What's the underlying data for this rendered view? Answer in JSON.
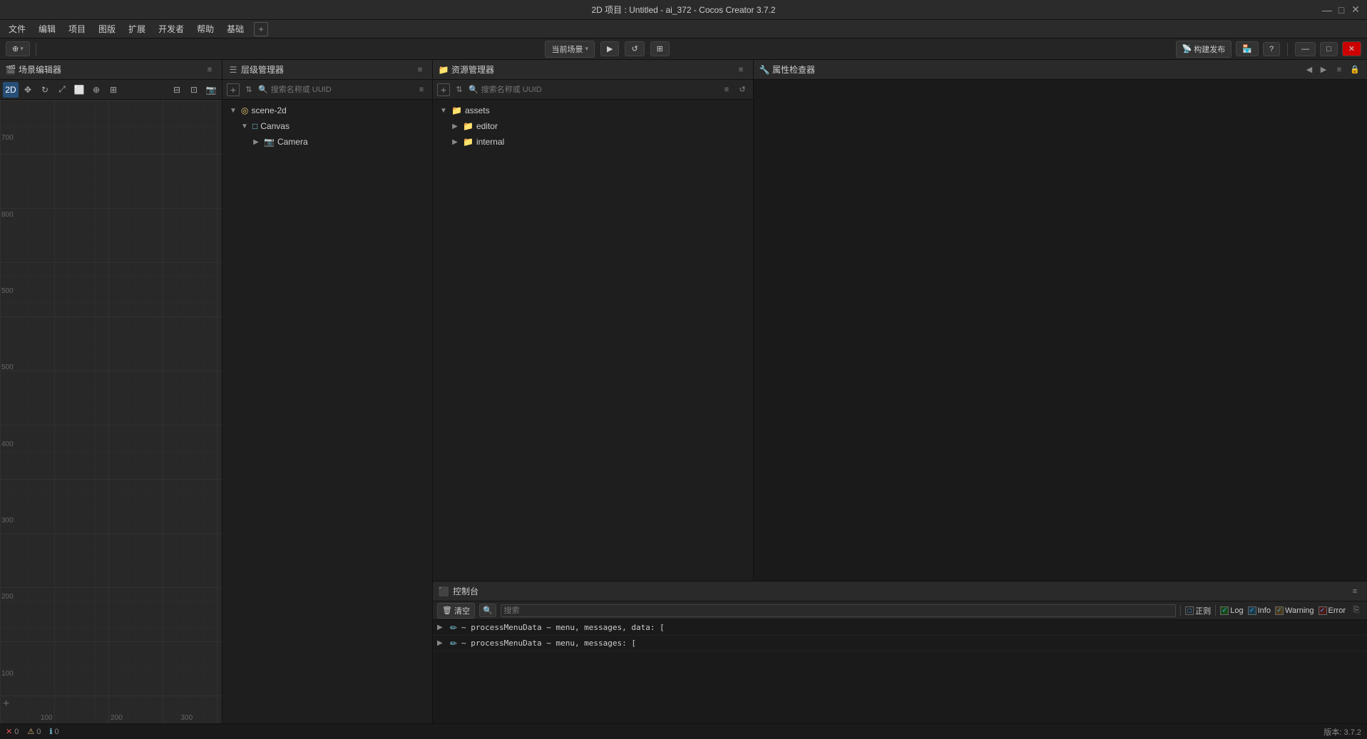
{
  "titleBar": {
    "title": "2D 项目 : Untitled - ai_372 - Cocos Creator 3.7.2",
    "minimize": "—",
    "maximize": "□",
    "close": "✕"
  },
  "menuBar": {
    "items": [
      "文件",
      "编辑",
      "项目",
      "图版",
      "扩展",
      "开发者",
      "帮助",
      "基础"
    ]
  },
  "globalToolbar": {
    "cursor_label": "当前场景",
    "play": "▶",
    "refresh": "↺",
    "grid": "⊞",
    "build": "构建发布",
    "back": "←",
    "help": "?"
  },
  "scenePanel": {
    "title": "场景编辑器",
    "mode2d": "2D",
    "labels": [
      "100",
      "200",
      "300",
      "700",
      "800",
      "500",
      "500",
      "400",
      "300",
      "200",
      "100"
    ]
  },
  "hierarchyPanel": {
    "title": "层级管理器",
    "searchPlaceholder": "搜索名称或 UUID",
    "tree": [
      {
        "id": "scene2d",
        "label": "scene-2d",
        "type": "scene",
        "indent": 0,
        "expanded": true
      },
      {
        "id": "canvas",
        "label": "Canvas",
        "type": "node",
        "indent": 1,
        "expanded": true
      },
      {
        "id": "camera",
        "label": "Camera",
        "type": "node",
        "indent": 2,
        "expanded": false
      }
    ]
  },
  "assetPanel": {
    "title": "资源管理器",
    "searchPlaceholder": "搜索名称或 UUID",
    "tree": [
      {
        "id": "assets",
        "label": "assets",
        "type": "folder",
        "indent": 0,
        "expanded": true
      },
      {
        "id": "editor",
        "label": "editor",
        "type": "folder",
        "indent": 1,
        "expanded": false
      },
      {
        "id": "internal",
        "label": "internal",
        "type": "folder",
        "indent": 1,
        "expanded": false
      }
    ]
  },
  "propertiesPanel": {
    "title": "属性检查器"
  },
  "consolePanel": {
    "title": "控制台",
    "clearLabel": "清空",
    "searchPlaceholder": "搜索",
    "normalLabel": "正则",
    "filters": [
      {
        "id": "log",
        "label": "Log",
        "checked": true
      },
      {
        "id": "info",
        "label": "Info",
        "checked": true
      },
      {
        "id": "warning",
        "label": "Warning",
        "checked": true
      },
      {
        "id": "error",
        "label": "Error",
        "checked": true
      }
    ],
    "messages": [
      {
        "id": "msg1",
        "text": "~ processMenuData ~ menu, messages, data: [",
        "type": "log"
      },
      {
        "id": "msg2",
        "text": "~ processMenuData ~ menu, messages: [",
        "type": "log"
      }
    ]
  },
  "statusBar": {
    "errors": "0",
    "warnings": "0",
    "logs": "0",
    "version": "版本: 3.7.2",
    "errorIcon": "✕",
    "warningIcon": "⚠",
    "logIcon": "ℹ"
  }
}
